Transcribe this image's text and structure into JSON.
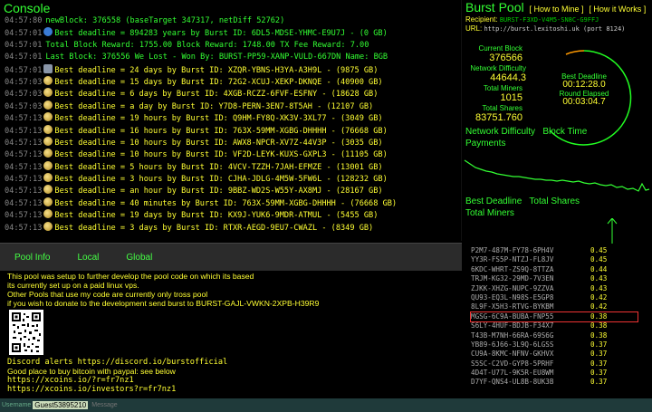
{
  "console": {
    "title": "Console",
    "lines": [
      {
        "ts": "04:57:80",
        "icon": "",
        "cls": "g",
        "text": "newBlock: 376558  (baseTarget 347317, netDiff 52762)"
      },
      {
        "ts": "04:57:01",
        "icon": "info",
        "cls": "g",
        "text": "Best deadline = 894283 years by Burst ID: 6DL5-MDSE-YHMC-E9U7J - (0 GB)"
      },
      {
        "ts": "04:57:01",
        "icon": "",
        "cls": "g",
        "text": "Total Block Reward: 1755.00  Block Reward: 1748.00  TX Fee Reward: 7.00"
      },
      {
        "ts": "04:57:01",
        "icon": "",
        "cls": "g",
        "text": "Last Block: 376556  We Lost -  Won By: BURST-PP59-XANP-VULD-667DN Name: BGB"
      },
      {
        "ts": "04:57:01",
        "icon": "pc",
        "cls": "",
        "text": "Best deadline = 24 days by Burst ID: XZQR-YBNS-H3YA-A3H9L - (9875 GB)"
      },
      {
        "ts": "04:57:03",
        "icon": "miner",
        "cls": "",
        "text": "Best deadline = 15 days by Burst ID: 72G2-XCUJ-XEKP-DKNQE - (40900 GB)"
      },
      {
        "ts": "04:57:03",
        "icon": "miner",
        "cls": "",
        "text": "Best deadline = 6 days by Burst ID: 4XGB-RCZZ-6FVF-ESFNY - (18628 GB)"
      },
      {
        "ts": "04:57:03",
        "icon": "miner",
        "cls": "",
        "text": "Best deadline = a day by Burst ID: Y7D8-PERN-3EN7-8T5AH - (12107 GB)"
      },
      {
        "ts": "04:57:13",
        "icon": "miner",
        "cls": "",
        "text": "Best deadline = 19 hours by Burst ID: Q9HM-FY8Q-XK3V-3XL77 - (3049 GB)"
      },
      {
        "ts": "04:57:13",
        "icon": "miner",
        "cls": "",
        "text": "Best deadline = 16 hours by Burst ID: 763X-59MM-XGBG-DHHHH - (76668 GB)"
      },
      {
        "ts": "04:57:13",
        "icon": "miner",
        "cls": "",
        "text": "Best deadline = 10 hours by Burst ID: AWX8-NPCR-XV7Z-44V3P - (3035 GB)"
      },
      {
        "ts": "04:57:13",
        "icon": "miner",
        "cls": "",
        "text": "Best deadline = 10 hours by Burst ID: VF2D-LEYK-KUXS-GXPL3 - (11105 GB)"
      },
      {
        "ts": "04:57:13",
        "icon": "miner",
        "cls": "",
        "text": "Best deadline = 5 hours by Burst ID: 4VCV-TZZH-7JAH-EFMZE - (13001 GB)"
      },
      {
        "ts": "04:57:13",
        "icon": "miner",
        "cls": "",
        "text": "Best deadline = 3 hours by Burst ID: CJHA-JDLG-4M5W-5FW6L - (128232 GB)"
      },
      {
        "ts": "04:57:13",
        "icon": "miner",
        "cls": "",
        "text": "Best deadline = an hour by Burst ID: 9BBZ-WD2S-W55Y-AX8MJ - (28167 GB)"
      },
      {
        "ts": "04:57:13",
        "icon": "miner",
        "cls": "",
        "text": "Best deadline = 40 minutes by Burst ID: 763X-59MM-XGBG-DHHHH - (76668 GB)"
      },
      {
        "ts": "04:57:13",
        "icon": "miner",
        "cls": "",
        "text": "Best deadline = 19 days by Burst ID: KX9J-YUK6-9MDR-ATMUL - (5455 GB)"
      },
      {
        "ts": "04:57:13",
        "icon": "miner",
        "cls": "",
        "text": "Best deadline = 3 days by Burst ID: RTXR-AEGD-9EU7-CWAZL - (8349 GB)"
      }
    ]
  },
  "info": {
    "tabs": [
      "Pool Info",
      "Local",
      "Global"
    ],
    "lines_top": [
      "This pool was setup to further develop the pool code on which its based",
      "its currently set up on a paid linux vps.",
      "Other Pools that use my code are currently only tross pool",
      "if you wish to donate to the development send burst to BURST-GAJL-VWKN-2XPB-H39R9"
    ],
    "lines_bottom": [
      {
        "text": "Discord alerts https://discord.io/burstofficial",
        "mono": true
      },
      {
        "text": "Good place to buy bitcoin with paypal: see below",
        "mono": false
      },
      {
        "text": "https://xcoins.io/?r=fr7nz1",
        "mono": true
      },
      {
        "text": "https://xcoins.io/investors?r=fr7nz1",
        "mono": true
      }
    ]
  },
  "bottom": {
    "user_label": "Username",
    "user_name": "Guest53895210",
    "message_placeholder": "Message"
  },
  "pool": {
    "title": "Burst Pool",
    "how_to_mine": "[ How to Mine ]",
    "how_it_works": "[ How it Works ]",
    "recipient_label": "Recipient:",
    "recipient_value": "BURST-F3XD-V4M5-SN8C-G9FFJ",
    "url_label": "URL:",
    "url_value": "http://burst.lexitoshi.uk (port 8124)",
    "stats": [
      {
        "label": "Current Block",
        "value": "376566"
      },
      {
        "label": "Network Difficulty",
        "value": "44644.3"
      },
      {
        "label": "Total Miners",
        "value": "1015"
      },
      {
        "label": "Total Shares",
        "value": "83751.760"
      }
    ],
    "best_deadline_label": "Best Deadline",
    "best_deadline_value": "00:12:28.0",
    "round_elapsed_label": "Round Elapsed",
    "round_elapsed_value": "00:03:04.7",
    "chart1_labels": [
      "Network Difficulty",
      "Block Time",
      "Payments"
    ],
    "chart2_labels": [
      "Best Deadline",
      "Total Shares",
      "Total Miners"
    ],
    "miners": [
      {
        "id": "P2M7-487M-FY78-6PH4V",
        "v": "0.45"
      },
      {
        "id": "YY3R-FS5P-NTZJ-FL8JV",
        "v": "0.45"
      },
      {
        "id": "6KDC-WHRT-ZS9Q-8TTZA",
        "v": "0.44"
      },
      {
        "id": "TRJM-KG32-29MD-7V3EN",
        "v": "0.43"
      },
      {
        "id": "ZJKK-XHZG-NUPC-9ZZVA",
        "v": "0.43"
      },
      {
        "id": "QU93-EQ3L-N98S-E5GP8",
        "v": "0.42"
      },
      {
        "id": "8L9F-X5H3-RTVG-BYKBM",
        "v": "0.42"
      },
      {
        "id": "MGSG-6C9A-BUBA-FNP55",
        "v": "0.38"
      },
      {
        "id": "S6LY-4HUF-BDJB-F34X7",
        "v": "0.38"
      },
      {
        "id": "T43B-M7NH-66RA-69S6G",
        "v": "0.38"
      },
      {
        "id": "YB89-6J66-3L9Q-6LGSS",
        "v": "0.37"
      },
      {
        "id": "CU9A-8KMC-NFNV-GKHVX",
        "v": "0.37"
      },
      {
        "id": "S5SC-C2VD-GYP8-5PRHF",
        "v": "0.37"
      },
      {
        "id": "4D4T-U77L-9K5R-EU8WM",
        "v": "0.37"
      },
      {
        "id": "D7YF-QNS4-UL8B-8UK3B",
        "v": "0.37"
      }
    ],
    "highlighted_miner": 7
  }
}
